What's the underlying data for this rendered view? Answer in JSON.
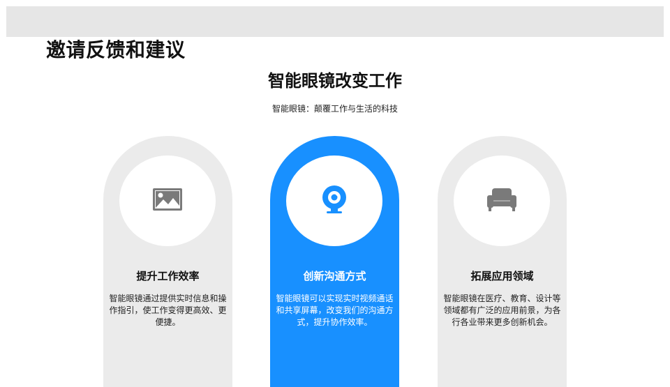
{
  "header": {
    "title": "邀请反馈和建议"
  },
  "main": {
    "title": "智能眼镜改变工作",
    "subtitle": "智能眼镜：颠覆工作与生活的科技"
  },
  "cards": [
    {
      "icon": "image-icon",
      "title": "提升工作效率",
      "desc": "智能眼镜通过提供实时信息和操作指引，使工作变得更高效、更便捷。"
    },
    {
      "icon": "webcam-icon",
      "title": "创新沟通方式",
      "desc": "智能眼镜可以实现实时视频通话和共享屏幕，改变我们的沟通方式，提升协作效率。"
    },
    {
      "icon": "sofa-icon",
      "title": "拓展应用领域",
      "desc": "智能眼镜在医疗、教育、设计等领域都有广泛的应用前景，为各行各业带来更多创新机会。"
    }
  ],
  "colors": {
    "accent": "#1890ff",
    "card_gray": "#ebebeb",
    "icon_gray": "#7a7a7a",
    "top_bar": "#e6e6e6"
  }
}
